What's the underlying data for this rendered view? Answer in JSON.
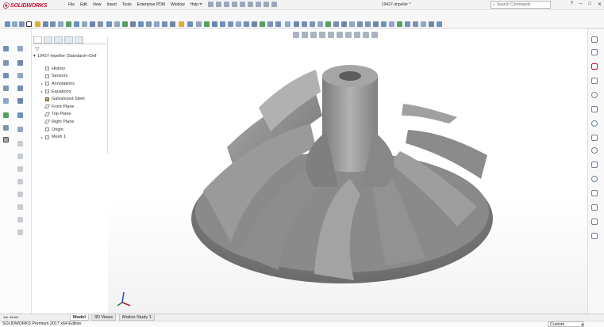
{
  "app": {
    "logo_text": "SOLIDWORKS",
    "document_title": "19427-impeller *"
  },
  "menu": [
    "File",
    "Edit",
    "View",
    "Insert",
    "Tools",
    "Enterprise PDM",
    "Window",
    "Help"
  ],
  "search": {
    "placeholder": "Search Commands"
  },
  "feature_tree": {
    "root": "19427-impeller  (Standard<<Def",
    "items": [
      {
        "label": "History",
        "icon": "history-icon",
        "expandable": false
      },
      {
        "label": "Sensors",
        "icon": "sensors-icon",
        "expandable": false
      },
      {
        "label": "Annotations",
        "icon": "annotations-icon",
        "expandable": true
      },
      {
        "label": "Equations",
        "icon": "equations-icon",
        "expandable": true
      },
      {
        "label": "Galvanized Steel",
        "icon": "material-icon",
        "expandable": false
      },
      {
        "label": "Front Plane",
        "icon": "plane-icon",
        "expandable": false
      },
      {
        "label": "Top Plane",
        "icon": "plane-icon",
        "expandable": false
      },
      {
        "label": "Right Plane",
        "icon": "plane-icon",
        "expandable": false
      },
      {
        "label": "Origin",
        "icon": "origin-icon",
        "expandable": false
      },
      {
        "label": "Mesh 1",
        "icon": "mesh-icon",
        "expandable": true
      }
    ]
  },
  "bottom_tabs": [
    {
      "label": "Model",
      "selected": true
    },
    {
      "label": "3D Views",
      "selected": false
    },
    {
      "label": "Motion Study 1",
      "selected": false
    }
  ],
  "status": {
    "left": "SOLIDWORKS Premium 2017 x64 Edition",
    "units": "Custom"
  },
  "colors": {
    "accent": "#c8102e",
    "model": "#8e8e8e",
    "icon_blue": "#5b7fb1"
  }
}
